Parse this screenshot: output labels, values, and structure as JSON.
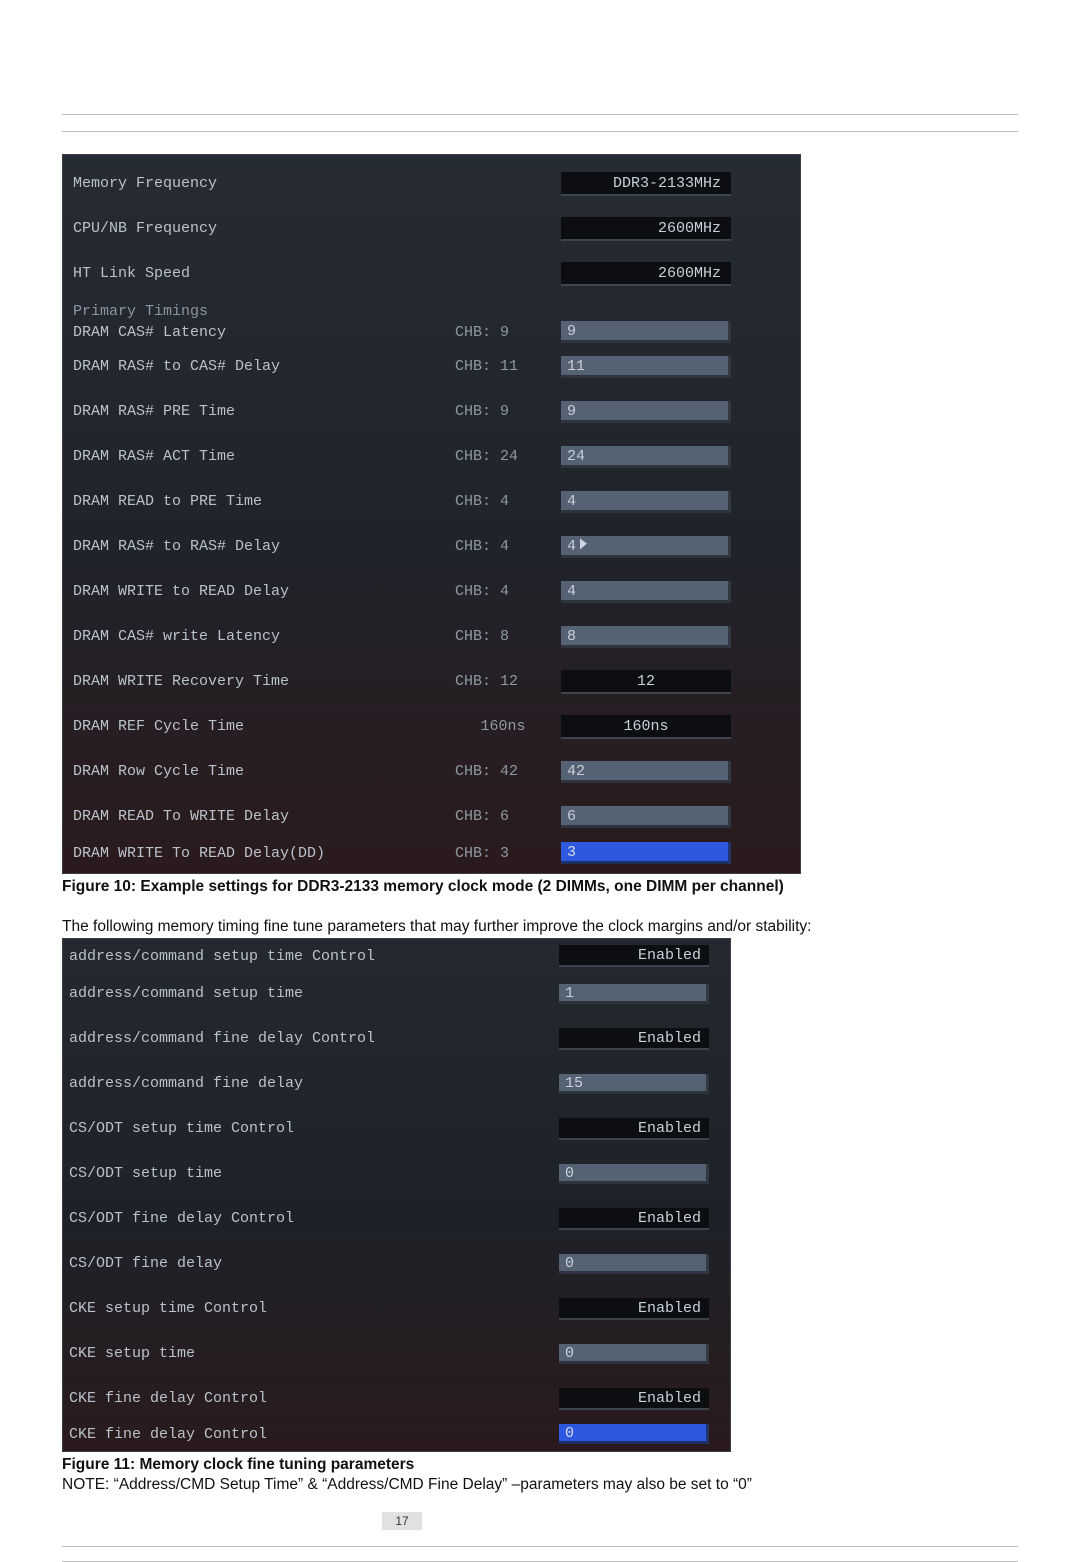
{
  "page_number": "17",
  "captions": {
    "fig10": "Figure 10: Example settings for DDR3-2133 memory clock mode (2 DIMMs, one DIMM per channel)",
    "fig11": "Figure 11: Memory clock fine tuning parameters"
  },
  "body_text": {
    "intro_fine_tune": "The following memory timing fine tune parameters that may further improve the clock margins and/or stability:",
    "note": "NOTE: “Address/CMD Setup Time” & “Address/CMD Fine Delay” –parameters may also be set to “0”"
  },
  "bios1": {
    "top": [
      {
        "label": "Memory Frequency",
        "type": "select",
        "value": "DDR3-2133MHz"
      },
      {
        "label": "CPU/NB Frequency",
        "type": "select",
        "value": "2600MHz"
      },
      {
        "label": "HT Link Speed",
        "type": "select",
        "value": "2600MHz"
      }
    ],
    "section": "Primary Timings",
    "rows": [
      {
        "label": "DRAM CAS# Latency",
        "sub": "CHB:  9",
        "type": "input",
        "value": "9"
      },
      {
        "label": "DRAM RAS# to CAS# Delay",
        "sub": "CHB:  11",
        "type": "input",
        "value": "11"
      },
      {
        "label": "DRAM RAS# PRE Time",
        "sub": "CHB:  9",
        "type": "input",
        "value": "9"
      },
      {
        "label": "DRAM RAS# ACT Time",
        "sub": "CHB:  24",
        "type": "input",
        "value": "24"
      },
      {
        "label": "DRAM READ to PRE Time",
        "sub": "CHB:  4",
        "type": "input",
        "value": "4"
      },
      {
        "label": "DRAM RAS# to RAS# Delay",
        "sub": "CHB:  4",
        "type": "input",
        "value": "4",
        "cursor": true
      },
      {
        "label": "DRAM WRITE to READ Delay",
        "sub": "CHB:  4",
        "type": "input",
        "value": "4"
      },
      {
        "label": "DRAM CAS# write Latency",
        "sub": "CHB:  8",
        "type": "input",
        "value": "8"
      },
      {
        "label": "DRAM WRITE Recovery Time",
        "sub": "CHB:  12",
        "type": "select",
        "value": "12"
      },
      {
        "label": "DRAM REF Cycle Time",
        "sub": "160ns",
        "type": "select",
        "value": "160ns"
      },
      {
        "label": "DRAM Row Cycle Time",
        "sub": "CHB:  42",
        "type": "input",
        "value": "42"
      },
      {
        "label": "DRAM READ To WRITE Delay",
        "sub": "CHB:  6",
        "type": "input",
        "value": "6"
      },
      {
        "label": "DRAM WRITE To READ Delay(DD)",
        "sub": "CHB:  3",
        "type": "input",
        "value": "3",
        "active": true
      }
    ]
  },
  "bios2": {
    "rows": [
      {
        "label": "address/command setup time Control",
        "type": "select",
        "value": "Enabled"
      },
      {
        "label": "address/command setup time",
        "type": "input",
        "value": "1"
      },
      {
        "label": "address/command fine delay Control",
        "type": "select",
        "value": "Enabled"
      },
      {
        "label": "address/command fine delay",
        "type": "input",
        "value": "15"
      },
      {
        "label": "CS/ODT setup time Control",
        "type": "select",
        "value": "Enabled"
      },
      {
        "label": "CS/ODT setup time",
        "type": "input",
        "value": "0"
      },
      {
        "label": "CS/ODT fine delay Control",
        "type": "select",
        "value": "Enabled"
      },
      {
        "label": "CS/ODT fine delay",
        "type": "input",
        "value": "0"
      },
      {
        "label": "CKE setup time Control",
        "type": "select",
        "value": "Enabled"
      },
      {
        "label": "CKE setup time",
        "type": "input",
        "value": "0"
      },
      {
        "label": "CKE fine delay Control",
        "type": "select",
        "value": "Enabled"
      },
      {
        "label": "CKE fine delay Control",
        "type": "input",
        "value": "0",
        "active": true
      }
    ]
  }
}
